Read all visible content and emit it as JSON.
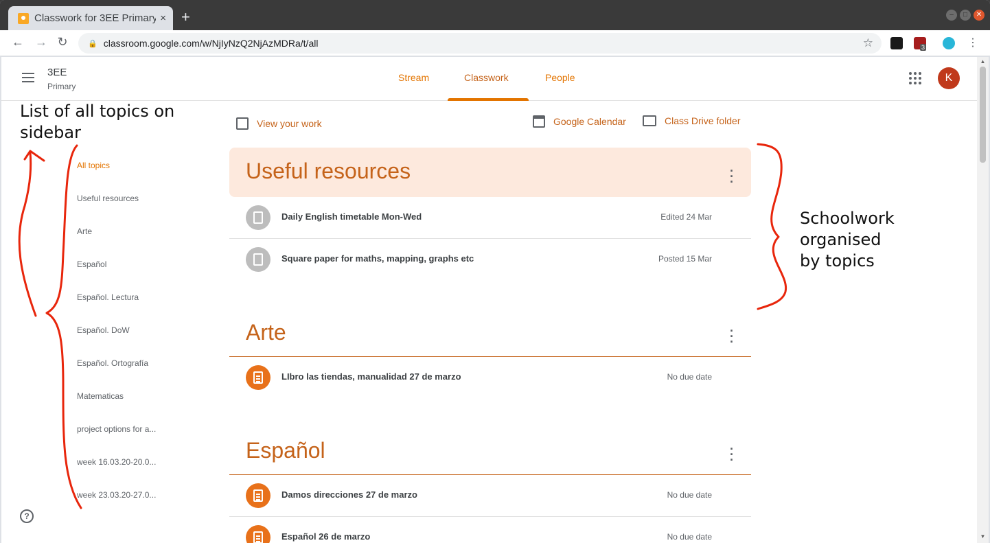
{
  "browser": {
    "tab_title": "Classwork for 3EE Primary",
    "tab_close": "×",
    "new_tab": "+",
    "url": "classroom.google.com/w/NjIyNzQ2NjAzMDRa/t/all",
    "extension_badge": "3"
  },
  "header": {
    "class_name": "3EE",
    "class_section": "Primary",
    "tabs": [
      {
        "label": "Stream"
      },
      {
        "label": "Classwork"
      },
      {
        "label": "People"
      }
    ],
    "active_tab": "Classwork",
    "avatar_letter": "K"
  },
  "sidebar": {
    "topics": [
      "All topics",
      "Useful resources",
      "Arte",
      "Español",
      "Español. Lectura",
      "Español. DoW",
      "Español. Ortografía",
      "Matematicas",
      "project options for a...",
      "week 16.03.20-20.0...",
      "week 23.03.20-27.0..."
    ],
    "help": "?"
  },
  "actions": {
    "view_work": "View your work",
    "calendar": "Google Calendar",
    "drive": "Class Drive folder"
  },
  "topics": [
    {
      "title": "Useful resources",
      "items": [
        {
          "title": "Daily English timetable Mon-Wed",
          "meta": "Edited 24 Mar"
        },
        {
          "title": "Square paper for maths, mapping, graphs etc",
          "meta": "Posted 15 Mar"
        }
      ]
    },
    {
      "title": "Arte",
      "items": [
        {
          "title": "LIbro las tiendas, manualidad 27 de marzo",
          "meta": "No due date"
        }
      ]
    },
    {
      "title": "Español",
      "items": [
        {
          "title": "Damos direcciones 27 de marzo",
          "meta": "No due date"
        },
        {
          "title": "Español 26 de marzo",
          "meta": "No due date"
        }
      ]
    }
  ],
  "annotations": {
    "left_line1": "List of all topics on",
    "left_line2": "sidebar",
    "right_line1": "Schoolwork",
    "right_line2": "organised",
    "right_line3": "by topics"
  },
  "colors": {
    "accent": "#e37400",
    "topic_text": "#c5631a",
    "banner": "#fde9dd",
    "annotation_ink": "#e8260c"
  }
}
